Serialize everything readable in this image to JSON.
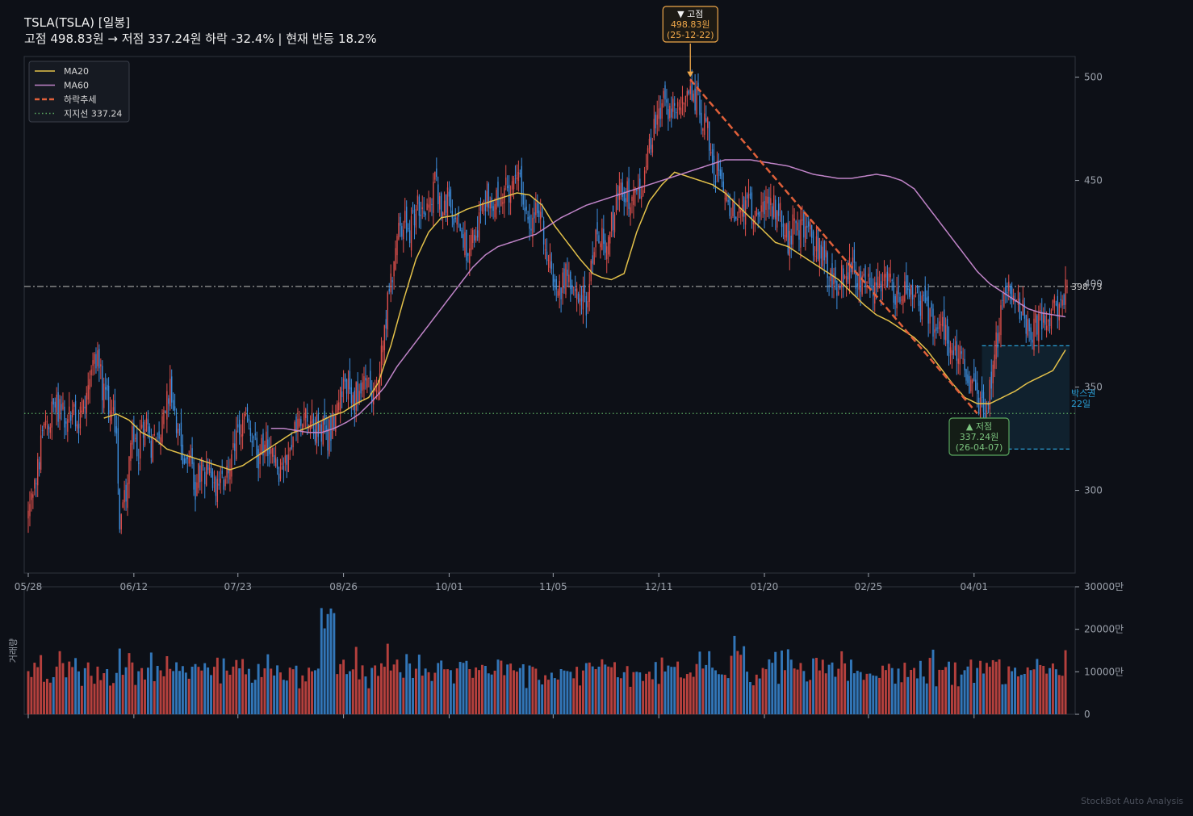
{
  "title": {
    "line1": "TSLA(TSLA)  [일봉]",
    "line2": "고점 498.83원 → 저점 337.24원  하락 -32.4%  |  현재 반등 18.2%"
  },
  "watermark": "StockBot Auto Analysis",
  "colors": {
    "background": "#0d1017",
    "up": "#e0504c",
    "down": "#3d8fe0",
    "ma20": "#e3c14a",
    "ma60": "#c084c8",
    "trend": "#e0603a",
    "support": "#5aa860",
    "box": "#2a9fd6",
    "peak": "#f0a84a"
  },
  "chart_data": {
    "type": "candlestick",
    "x_tick_labels": [
      "05/28",
      "06/12",
      "07/23",
      "08/26",
      "10/01",
      "11/05",
      "12/11",
      "01/20",
      "02/25",
      "04/01"
    ],
    "y_ticks": [
      300,
      350,
      400,
      450,
      500
    ],
    "y_tick_labels": [
      "300",
      "350",
      "400",
      "450",
      "500"
    ],
    "ylim": [
      260,
      510
    ],
    "peak": {
      "value": 498.83,
      "date": "25-12-22",
      "label": "▼ 고점",
      "price_label": "498.83원",
      "date_label": "(25-12-22)"
    },
    "trough": {
      "value": 337.24,
      "date": "26-04-07",
      "label": "▲ 저점",
      "price_label": "337.24원",
      "date_label": "(26-04-07)"
    },
    "support": 337.24,
    "current_price": 398.73,
    "current_price_label": "398.73",
    "box": {
      "low": 320,
      "high": 370,
      "label_line1": "박스권",
      "label_line2": "22일"
    },
    "legend": [
      {
        "name": "MA20",
        "style": "solid",
        "color": "#e3c14a"
      },
      {
        "name": "MA60",
        "style": "solid",
        "color": "#c084c8"
      },
      {
        "name": "하락추세",
        "style": "dashed",
        "color": "#e0603a"
      },
      {
        "name": "지지선 337.24",
        "style": "dotted",
        "color": "#5aa860"
      }
    ],
    "legend_position": "top-left",
    "volume": {
      "ylabel": "거래량",
      "y_ticks": [
        0,
        10000,
        20000,
        30000
      ],
      "y_tick_labels": [
        "0",
        "10000만",
        "20000만",
        "30000만"
      ],
      "ylim": [
        0,
        30000
      ]
    },
    "price_path": [
      [
        0,
        288
      ],
      [
        4,
        300
      ],
      [
        8,
        320
      ],
      [
        12,
        335
      ],
      [
        16,
        340
      ],
      [
        20,
        340
      ],
      [
        24,
        335
      ],
      [
        28,
        337
      ],
      [
        32,
        333
      ],
      [
        36,
        345
      ],
      [
        40,
        362
      ],
      [
        44,
        365
      ],
      [
        48,
        345
      ],
      [
        52,
        338
      ],
      [
        56,
        330
      ],
      [
        58,
        285
      ],
      [
        62,
        300
      ],
      [
        66,
        325
      ],
      [
        70,
        320
      ],
      [
        74,
        330
      ],
      [
        78,
        322
      ],
      [
        82,
        330
      ],
      [
        86,
        335
      ],
      [
        90,
        350
      ],
      [
        94,
        328
      ],
      [
        98,
        318
      ],
      [
        102,
        318
      ],
      [
        106,
        302
      ],
      [
        110,
        312
      ],
      [
        114,
        306
      ],
      [
        118,
        303
      ],
      [
        122,
        300
      ],
      [
        126,
        310
      ],
      [
        130,
        316
      ],
      [
        134,
        330
      ],
      [
        138,
        335
      ],
      [
        142,
        325
      ],
      [
        146,
        316
      ],
      [
        150,
        324
      ],
      [
        154,
        317
      ],
      [
        158,
        310
      ],
      [
        162,
        313
      ],
      [
        166,
        323
      ],
      [
        170,
        330
      ],
      [
        174,
        339
      ],
      [
        178,
        335
      ],
      [
        182,
        330
      ],
      [
        186,
        330
      ],
      [
        190,
        326
      ],
      [
        194,
        335
      ],
      [
        198,
        345
      ],
      [
        202,
        350
      ],
      [
        206,
        342
      ],
      [
        210,
        350
      ],
      [
        214,
        354
      ],
      [
        218,
        346
      ],
      [
        222,
        352
      ],
      [
        226,
        380
      ],
      [
        230,
        400
      ],
      [
        234,
        425
      ],
      [
        238,
        430
      ],
      [
        242,
        425
      ],
      [
        246,
        435
      ],
      [
        250,
        440
      ],
      [
        254,
        438
      ],
      [
        258,
        450
      ],
      [
        262,
        432
      ],
      [
        266,
        440
      ],
      [
        270,
        425
      ],
      [
        274,
        430
      ],
      [
        278,
        418
      ],
      [
        282,
        425
      ],
      [
        286,
        430
      ],
      [
        290,
        437
      ],
      [
        294,
        442
      ],
      [
        298,
        438
      ],
      [
        302,
        448
      ],
      [
        306,
        445
      ],
      [
        310,
        452
      ],
      [
        314,
        445
      ],
      [
        318,
        430
      ],
      [
        322,
        435
      ],
      [
        326,
        428
      ],
      [
        330,
        410
      ],
      [
        334,
        400
      ],
      [
        338,
        395
      ],
      [
        342,
        410
      ],
      [
        346,
        395
      ],
      [
        350,
        398
      ],
      [
        354,
        390
      ],
      [
        358,
        415
      ],
      [
        362,
        425
      ],
      [
        366,
        420
      ],
      [
        370,
        430
      ],
      [
        374,
        440
      ],
      [
        378,
        445
      ],
      [
        382,
        442
      ],
      [
        386,
        445
      ],
      [
        390,
        450
      ],
      [
        394,
        470
      ],
      [
        398,
        478
      ],
      [
        402,
        488
      ],
      [
        406,
        486
      ],
      [
        410,
        485
      ],
      [
        414,
        480
      ],
      [
        418,
        495
      ],
      [
        422,
        490
      ],
      [
        426,
        485
      ],
      [
        430,
        478
      ],
      [
        434,
        460
      ],
      [
        438,
        452
      ],
      [
        442,
        440
      ],
      [
        446,
        438
      ],
      [
        450,
        430
      ],
      [
        454,
        435
      ],
      [
        458,
        440
      ],
      [
        462,
        430
      ],
      [
        466,
        438
      ],
      [
        470,
        440
      ],
      [
        474,
        435
      ],
      [
        478,
        432
      ],
      [
        482,
        420
      ],
      [
        486,
        430
      ],
      [
        490,
        425
      ],
      [
        494,
        428
      ],
      [
        498,
        420
      ],
      [
        502,
        418
      ],
      [
        506,
        410
      ],
      [
        510,
        400
      ],
      [
        514,
        395
      ],
      [
        518,
        410
      ],
      [
        522,
        408
      ],
      [
        526,
        402
      ],
      [
        530,
        398
      ],
      [
        534,
        400
      ],
      [
        538,
        395
      ],
      [
        542,
        402
      ],
      [
        546,
        400
      ],
      [
        550,
        395
      ],
      [
        554,
        398
      ],
      [
        558,
        392
      ],
      [
        562,
        395
      ],
      [
        566,
        390
      ],
      [
        570,
        386
      ],
      [
        574,
        380
      ],
      [
        578,
        385
      ],
      [
        582,
        378
      ],
      [
        586,
        365
      ],
      [
        590,
        370
      ],
      [
        594,
        360
      ],
      [
        598,
        350
      ],
      [
        602,
        345
      ],
      [
        606,
        340
      ],
      [
        610,
        348
      ],
      [
        614,
        370
      ],
      [
        618,
        390
      ],
      [
        622,
        395
      ],
      [
        626,
        392
      ],
      [
        630,
        388
      ],
      [
        634,
        380
      ],
      [
        638,
        378
      ],
      [
        642,
        382
      ],
      [
        646,
        380
      ],
      [
        650,
        388
      ],
      [
        654,
        392
      ],
      [
        658,
        398
      ]
    ],
    "ma20_path": [
      [
        48,
        335
      ],
      [
        56,
        337
      ],
      [
        64,
        334
      ],
      [
        72,
        328
      ],
      [
        80,
        325
      ],
      [
        88,
        320
      ],
      [
        96,
        318
      ],
      [
        104,
        316
      ],
      [
        112,
        314
      ],
      [
        120,
        312
      ],
      [
        128,
        310
      ],
      [
        136,
        312
      ],
      [
        144,
        316
      ],
      [
        152,
        320
      ],
      [
        160,
        324
      ],
      [
        168,
        328
      ],
      [
        176,
        330
      ],
      [
        184,
        333
      ],
      [
        192,
        336
      ],
      [
        200,
        338
      ],
      [
        208,
        342
      ],
      [
        216,
        345
      ],
      [
        222,
        352
      ],
      [
        230,
        370
      ],
      [
        238,
        392
      ],
      [
        246,
        412
      ],
      [
        254,
        425
      ],
      [
        262,
        432
      ],
      [
        270,
        433
      ],
      [
        278,
        436
      ],
      [
        286,
        438
      ],
      [
        294,
        440
      ],
      [
        302,
        442
      ],
      [
        310,
        444
      ],
      [
        318,
        443
      ],
      [
        326,
        438
      ],
      [
        334,
        428
      ],
      [
        342,
        420
      ],
      [
        350,
        412
      ],
      [
        358,
        405
      ],
      [
        364,
        403
      ],
      [
        370,
        402
      ],
      [
        378,
        405
      ],
      [
        386,
        425
      ],
      [
        394,
        440
      ],
      [
        402,
        448
      ],
      [
        410,
        454
      ],
      [
        418,
        452
      ],
      [
        426,
        450
      ],
      [
        434,
        448
      ],
      [
        442,
        444
      ],
      [
        450,
        438
      ],
      [
        458,
        432
      ],
      [
        466,
        426
      ],
      [
        474,
        420
      ],
      [
        482,
        418
      ],
      [
        490,
        414
      ],
      [
        498,
        410
      ],
      [
        506,
        406
      ],
      [
        514,
        402
      ],
      [
        522,
        396
      ],
      [
        530,
        390
      ],
      [
        538,
        385
      ],
      [
        546,
        382
      ],
      [
        554,
        378
      ],
      [
        562,
        374
      ],
      [
        570,
        368
      ],
      [
        578,
        360
      ],
      [
        586,
        352
      ],
      [
        594,
        345
      ],
      [
        602,
        342
      ],
      [
        610,
        342
      ],
      [
        618,
        345
      ],
      [
        626,
        348
      ],
      [
        634,
        352
      ],
      [
        642,
        355
      ],
      [
        650,
        358
      ],
      [
        658,
        368
      ]
    ],
    "ma60_path": [
      [
        154,
        330
      ],
      [
        162,
        330
      ],
      [
        170,
        329
      ],
      [
        178,
        328
      ],
      [
        186,
        328
      ],
      [
        194,
        330
      ],
      [
        202,
        333
      ],
      [
        210,
        337
      ],
      [
        218,
        343
      ],
      [
        226,
        350
      ],
      [
        234,
        360
      ],
      [
        242,
        368
      ],
      [
        250,
        376
      ],
      [
        258,
        384
      ],
      [
        266,
        392
      ],
      [
        274,
        400
      ],
      [
        282,
        408
      ],
      [
        290,
        414
      ],
      [
        298,
        418
      ],
      [
        306,
        420
      ],
      [
        314,
        422
      ],
      [
        322,
        424
      ],
      [
        330,
        428
      ],
      [
        338,
        432
      ],
      [
        346,
        435
      ],
      [
        354,
        438
      ],
      [
        362,
        440
      ],
      [
        370,
        442
      ],
      [
        378,
        444
      ],
      [
        386,
        446
      ],
      [
        394,
        448
      ],
      [
        402,
        450
      ],
      [
        410,
        452
      ],
      [
        418,
        454
      ],
      [
        426,
        456
      ],
      [
        434,
        458
      ],
      [
        442,
        460
      ],
      [
        450,
        460
      ],
      [
        458,
        460
      ],
      [
        466,
        459
      ],
      [
        474,
        458
      ],
      [
        482,
        457
      ],
      [
        490,
        455
      ],
      [
        498,
        453
      ],
      [
        506,
        452
      ],
      [
        514,
        451
      ],
      [
        522,
        451
      ],
      [
        530,
        452
      ],
      [
        538,
        453
      ],
      [
        546,
        452
      ],
      [
        554,
        450
      ],
      [
        562,
        446
      ],
      [
        570,
        438
      ],
      [
        578,
        430
      ],
      [
        586,
        422
      ],
      [
        594,
        414
      ],
      [
        602,
        406
      ],
      [
        610,
        400
      ],
      [
        618,
        396
      ],
      [
        626,
        392
      ],
      [
        634,
        388
      ],
      [
        642,
        386
      ],
      [
        650,
        385
      ],
      [
        658,
        384
      ]
    ]
  }
}
